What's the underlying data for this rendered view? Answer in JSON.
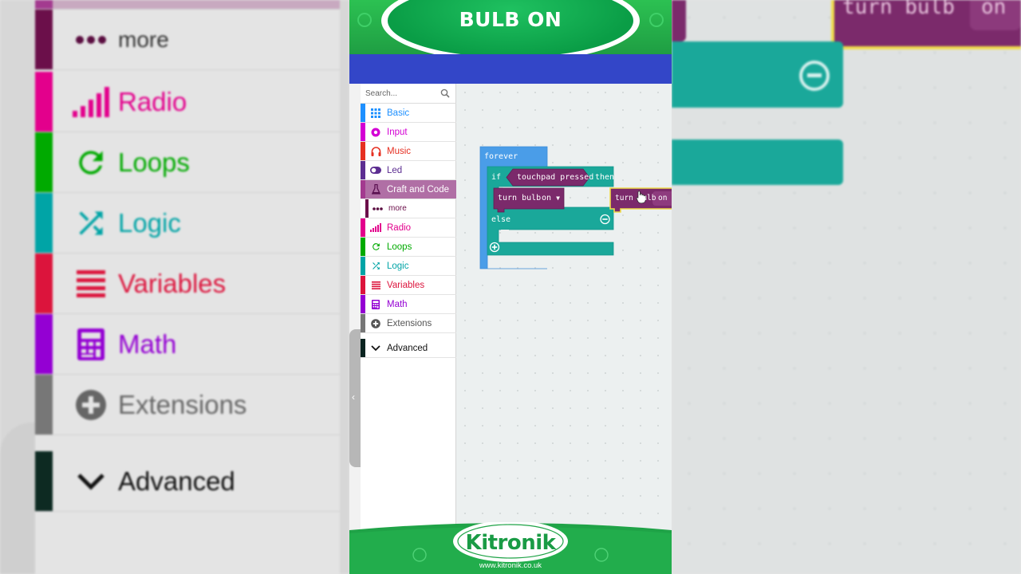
{
  "banner": {
    "title": "BULB ON"
  },
  "toolbox": {
    "search_placeholder": "Search...",
    "categories": [
      {
        "label": "Basic",
        "color": "#1e90ff",
        "icon": "grid-icon"
      },
      {
        "label": "Input",
        "color": "#d400d4",
        "icon": "circle-dot-icon"
      },
      {
        "label": "Music",
        "color": "#e63022",
        "icon": "headphones-icon"
      },
      {
        "label": "Led",
        "color": "#5c2d91",
        "icon": "toggle-icon"
      },
      {
        "label": "Craft and Code",
        "color": "#a33a8f",
        "icon": "flask-icon"
      },
      {
        "label": "more",
        "color": "#6b0f4a",
        "icon": "dots-icon"
      },
      {
        "label": "Radio",
        "color": "#e3008c",
        "icon": "signal-icon"
      },
      {
        "label": "Loops",
        "color": "#00aa00",
        "icon": "loop-icon"
      },
      {
        "label": "Logic",
        "color": "#00a4a6",
        "icon": "shuffle-icon"
      },
      {
        "label": "Variables",
        "color": "#dc143c",
        "icon": "list-icon"
      },
      {
        "label": "Math",
        "color": "#9400d3",
        "icon": "calculator-icon"
      },
      {
        "label": "Extensions",
        "color": "#777777",
        "icon": "plus-circle-icon"
      },
      {
        "label": "Advanced",
        "color": "#000000",
        "icon": "chevron-down-icon"
      }
    ]
  },
  "blocks": {
    "forever": "forever",
    "if_kw": "if",
    "condition": "touchpad pressed",
    "then_kw": "then",
    "action": "turn bulb",
    "action_value": "on",
    "else_kw": "else",
    "dragged_action": "turn bulb",
    "dragged_value": "on"
  },
  "footer": {
    "logo": "Kitronik",
    "url": "www.kitronik.co.uk"
  },
  "colors": {
    "loops_blue": "#4a9de8",
    "logic_teal": "#1aa89a",
    "craft_purple": "#7b2a6b",
    "header_blue": "#3346c8",
    "brand_green": "#1fa347"
  }
}
